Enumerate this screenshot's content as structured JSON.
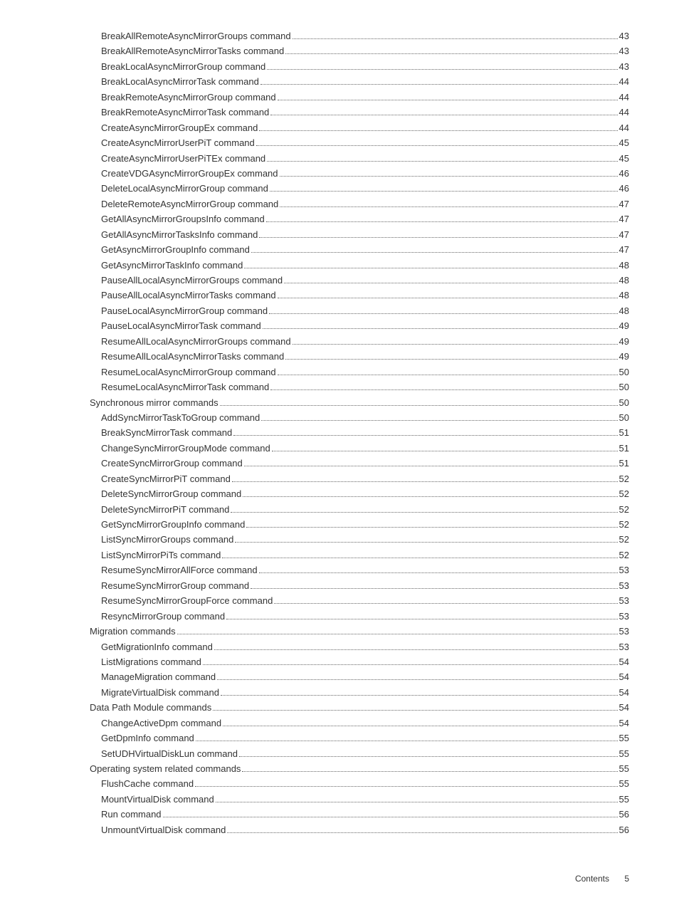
{
  "toc": [
    {
      "indent": 3,
      "title": "BreakAllRemoteAsyncMirrorGroups command",
      "page": "43"
    },
    {
      "indent": 3,
      "title": "BreakAllRemoteAsyncMirrorTasks command",
      "page": "43"
    },
    {
      "indent": 3,
      "title": "BreakLocalAsyncMirrorGroup command",
      "page": "43"
    },
    {
      "indent": 3,
      "title": "BreakLocalAsyncMirrorTask command",
      "page": "44"
    },
    {
      "indent": 3,
      "title": "BreakRemoteAsyncMirrorGroup command",
      "page": "44"
    },
    {
      "indent": 3,
      "title": "BreakRemoteAsyncMirrorTask command",
      "page": "44"
    },
    {
      "indent": 3,
      "title": "CreateAsyncMirrorGroupEx command",
      "page": "44"
    },
    {
      "indent": 3,
      "title": "CreateAsyncMirrorUserPiT command",
      "page": "45"
    },
    {
      "indent": 3,
      "title": "CreateAsyncMirrorUserPiTEx command",
      "page": "45"
    },
    {
      "indent": 3,
      "title": "CreateVDGAsyncMirrorGroupEx command",
      "page": "46"
    },
    {
      "indent": 3,
      "title": "DeleteLocalAsyncMirrorGroup command",
      "page": "46"
    },
    {
      "indent": 3,
      "title": "DeleteRemoteAsyncMirrorGroup command",
      "page": "47"
    },
    {
      "indent": 3,
      "title": "GetAllAsyncMirrorGroupsInfo command",
      "page": "47"
    },
    {
      "indent": 3,
      "title": "GetAllAsyncMirrorTasksInfo command",
      "page": "47"
    },
    {
      "indent": 3,
      "title": "GetAsyncMirrorGroupInfo command",
      "page": "47"
    },
    {
      "indent": 3,
      "title": "GetAsyncMirrorTaskInfo command",
      "page": "48"
    },
    {
      "indent": 3,
      "title": "PauseAllLocalAsyncMirrorGroups command",
      "page": "48"
    },
    {
      "indent": 3,
      "title": "PauseAllLocalAsyncMirrorTasks command",
      "page": "48"
    },
    {
      "indent": 3,
      "title": "PauseLocalAsyncMirrorGroup command",
      "page": "48"
    },
    {
      "indent": 3,
      "title": "PauseLocalAsyncMirrorTask command",
      "page": "49"
    },
    {
      "indent": 3,
      "title": "ResumeAllLocalAsyncMirrorGroups command",
      "page": "49"
    },
    {
      "indent": 3,
      "title": "ResumeAllLocalAsyncMirrorTasks command",
      "page": "49"
    },
    {
      "indent": 3,
      "title": "ResumeLocalAsyncMirrorGroup command",
      "page": "50"
    },
    {
      "indent": 3,
      "title": "ResumeLocalAsyncMirrorTask command",
      "page": "50"
    },
    {
      "indent": 2,
      "title": "Synchronous mirror commands",
      "page": "50"
    },
    {
      "indent": 3,
      "title": "AddSyncMirrorTaskToGroup command",
      "page": "50"
    },
    {
      "indent": 3,
      "title": "BreakSyncMirrorTask command",
      "page": "51"
    },
    {
      "indent": 3,
      "title": "ChangeSyncMirrorGroupMode command",
      "page": "51"
    },
    {
      "indent": 3,
      "title": "CreateSyncMirrorGroup command",
      "page": "51"
    },
    {
      "indent": 3,
      "title": "CreateSyncMirrorPiT command",
      "page": "52"
    },
    {
      "indent": 3,
      "title": "DeleteSyncMirrorGroup command",
      "page": "52"
    },
    {
      "indent": 3,
      "title": "DeleteSyncMirrorPiT command",
      "page": "52"
    },
    {
      "indent": 3,
      "title": "GetSyncMirrorGroupInfo command",
      "page": "52"
    },
    {
      "indent": 3,
      "title": "ListSyncMirrorGroups command",
      "page": "52"
    },
    {
      "indent": 3,
      "title": "ListSyncMirrorPiTs command",
      "page": "52"
    },
    {
      "indent": 3,
      "title": "ResumeSyncMirrorAllForce command",
      "page": "53"
    },
    {
      "indent": 3,
      "title": "ResumeSyncMirrorGroup command",
      "page": "53"
    },
    {
      "indent": 3,
      "title": "ResumeSyncMirrorGroupForce command",
      "page": "53"
    },
    {
      "indent": 3,
      "title": "ResyncMirrorGroup command",
      "page": "53"
    },
    {
      "indent": 2,
      "title": "Migration commands",
      "page": "53"
    },
    {
      "indent": 3,
      "title": "GetMigrationInfo command",
      "page": "53"
    },
    {
      "indent": 3,
      "title": "ListMigrations command",
      "page": "54"
    },
    {
      "indent": 3,
      "title": "ManageMigration command",
      "page": "54"
    },
    {
      "indent": 3,
      "title": "MigrateVirtualDisk command",
      "page": "54"
    },
    {
      "indent": 2,
      "title": "Data Path Module commands",
      "page": "54"
    },
    {
      "indent": 3,
      "title": "ChangeActiveDpm command",
      "page": "54"
    },
    {
      "indent": 3,
      "title": "GetDpmInfo command",
      "page": "55"
    },
    {
      "indent": 3,
      "title": "SetUDHVirtualDiskLun command",
      "page": "55"
    },
    {
      "indent": 2,
      "title": "Operating system related commands",
      "page": "55"
    },
    {
      "indent": 3,
      "title": "FlushCache command",
      "page": "55"
    },
    {
      "indent": 3,
      "title": "MountVirtualDisk command",
      "page": "55"
    },
    {
      "indent": 3,
      "title": "Run command",
      "page": "56"
    },
    {
      "indent": 3,
      "title": "UnmountVirtualDisk command",
      "page": "56"
    }
  ],
  "footer": {
    "label": "Contents",
    "page": "5"
  }
}
